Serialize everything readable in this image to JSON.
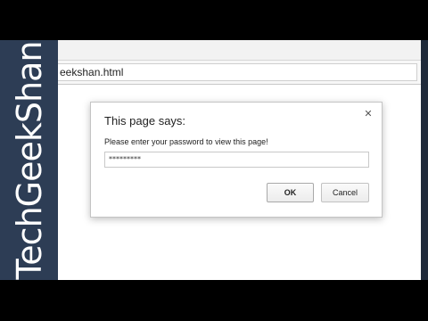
{
  "brand": {
    "bracket_left": "<",
    "name": "TechGeekShan",
    "bracket_right": ">"
  },
  "browser": {
    "address_text": "eekshan.html"
  },
  "dialog": {
    "title": "This page says:",
    "close_glyph": "✕",
    "message": "Please enter your password to view this page!",
    "input_value": "*********",
    "ok_label": "OK",
    "cancel_label": "Cancel"
  }
}
